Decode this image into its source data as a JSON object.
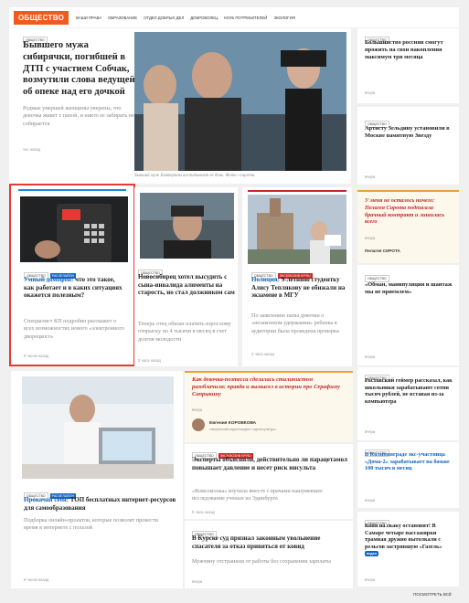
{
  "header": {
    "logo": "ОБЩЕСТВО",
    "nav": [
      "ВАШИ ПРАВА",
      "ОБРАЗОВАНИЕ",
      "ОТДЕЛ ДОБРЫХ ДЕЛ",
      "ДОБРОВОЛЕЦ",
      "КЛУБ ПОТРЕБИТЕЛЕЙ",
      "ЭКОЛОГИЯ"
    ]
  },
  "tags": {
    "society": "ОБЩЕСТВО",
    "explain": "РАСЧЕЛАЙОН",
    "exclusive": "ЭКСКЛЮЗИВ KP.RU"
  },
  "featured": {
    "title": "Бывшего мужа сибирячки, погибшей в ДТП с участием Собчак, возмутили слова ведущей об опеке над его дочкой",
    "lead": "Родные умершей женщины уверены, что девочка живет с папой, и никто ее забирать не собирается",
    "time": "час назад",
    "caption": "Бывший муж Екатерины воспитывает ее дочь. Фото: соцсети."
  },
  "right": [
    {
      "title": "Большинство россиян смогут прожить на свои накопления максимум три месяца",
      "time": "вчера"
    },
    {
      "title": "Артисту Зельдину установили в Москве памятную Звезду",
      "time": "вчера"
    },
    {
      "quote": "У меня не осталось ничего: Пелагея Сирота подписала брачный контракт и лишилась всего",
      "sub": "вчера",
      "author": "Пелагея СИРОТА"
    },
    {
      "title": "«Обман, манипуляции и шантаж мы не приемлем»",
      "time": "вчера"
    },
    {
      "title": "Ростовский геймер рассказал, как школьники зарабатывают сотни тысяч рублей, не вставая из-за компьютера",
      "time": "вчера"
    },
    {
      "title": "В Калининграде экс-участница «Дома-2» зарабатывает на бомже 100 тысяч в месяц",
      "time": "вчера"
    },
    {
      "title": "Коня на скаку остановит! В Самаре четыре пассажирки трамвая дружно вытолкали с рельсов застрявшую «Газель»",
      "badge": "видео",
      "time": "вчера"
    }
  ],
  "mid": [
    {
      "title": "Умный домофон:",
      "title_rest": " что это такое, как работает и в каких ситуациях окажется полезным?",
      "lead": "Специалист КП подробно расскажет о всех возможностях нового «электронного дворецкого»",
      "time": "9 часов назад"
    },
    {
      "title": "Новосибирец хотел высудить с сына-инвалида алименты на старость, но стал должником сам",
      "lead": "Теперь отец обязан платить взрослому отпрыску по 4 тысячи в месяц в счет долгов молодости",
      "time": "3 часа назад"
    },
    {
      "title": "Полиция:",
      "title_rest": " 9-летнюю студентку Алису Теплякову не обижали на экзамене в МГУ",
      "lead": "По заявлению папы девочки о «незаконном удержании» ребенка в аудитории была проведена проверка",
      "time": "3 часа назад"
    }
  ],
  "bottom_left": {
    "title": "Прокачай себя:",
    "title_rest": " ТОП бесплатных интернет-ресурсов для самообразования",
    "lead": "Подборка онлайн-проектов, которые позволят провести время в интернете с пользой",
    "time": "9 часов назад"
  },
  "opinion": {
    "quote": "Как девочка-поэтесса сделалась сталинистом разоблачила: правда и вымысел в истории про Серафиму Сапрыкину",
    "sub": "вчера",
    "author": "Евгения КОРОВКОВА",
    "role": "специальный корреспондент отдела культуры"
  },
  "mid_news": [
    {
      "title": "Эксперты объяснили, действительно ли парацетамол повышает давление и несет риск инсульта",
      "lead": "«Комсомолка» изучила вместе с врачами нашумевшее исследование ученых из Эдинбурга",
      "time": "5 часа назад"
    },
    {
      "title": "В Курске суд признал законным увольнение спасателя за отказ привиться от ковид",
      "lead": "Мужчину отстранили от работы без сохранения зарплаты",
      "time": "вчера"
    }
  ],
  "view_all": "ПОСМОТРЕТЬ ВСЁ"
}
